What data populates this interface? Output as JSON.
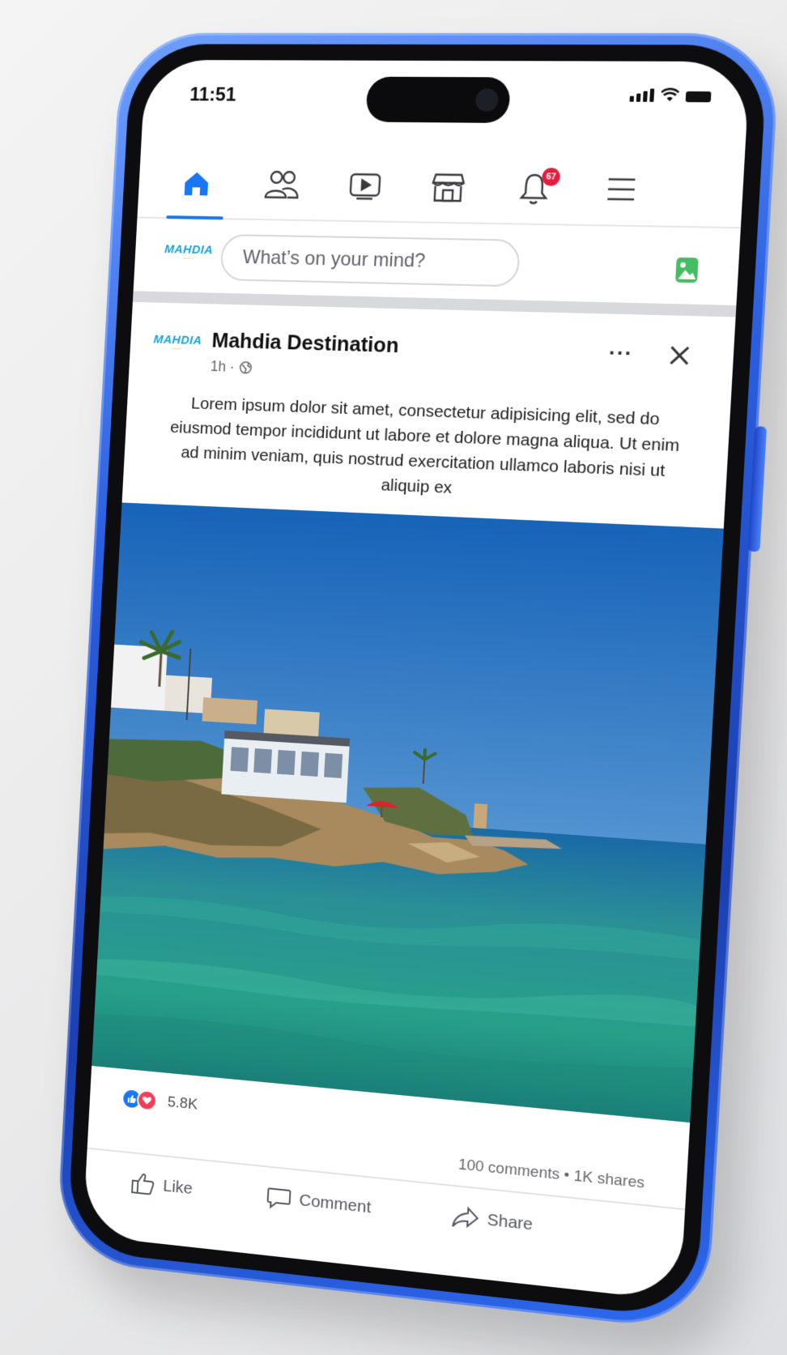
{
  "status_bar": {
    "time": "11:51"
  },
  "nav": {
    "items": [
      {
        "name": "home",
        "active": true
      },
      {
        "name": "friends"
      },
      {
        "name": "watch"
      },
      {
        "name": "marketplace"
      },
      {
        "name": "notifications",
        "badge": "67"
      },
      {
        "name": "menu"
      }
    ],
    "accent": "#1877f2"
  },
  "composer": {
    "placeholder": "What’s on your mind?",
    "logo_text": "MAHDIA"
  },
  "post": {
    "author": "Mahdia Destination",
    "time": "1h ·",
    "logo_text": "MAHDIA",
    "body": "Lorem ipsum dolor sit amet, consectetur adipisicing elit, sed do eiusmod tempor incididunt ut labore et dolore magna aliqua. Ut enim ad minim veniam, quis nostrud exercitation ullamco laboris nisi ut aliquip ex",
    "reaction_count": "5.8K",
    "stats": "100 comments • 1K shares",
    "actions": {
      "like": "Like",
      "comment": "Comment",
      "share": "Share"
    }
  },
  "colors": {
    "phone_body": "#2a5fe0",
    "like": "#1877f2",
    "love": "#f33e58",
    "badge": "#e41e3f"
  }
}
